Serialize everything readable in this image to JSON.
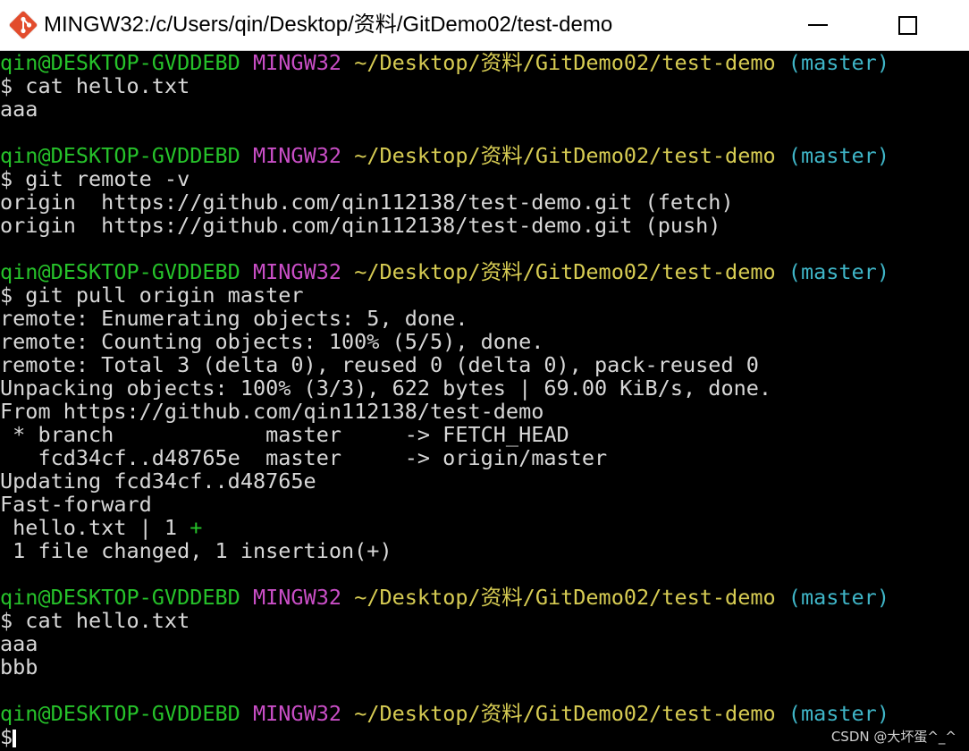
{
  "window": {
    "title": "MINGW32:/c/Users/qin/Desktop/资料/GitDemo02/test-demo",
    "icon": "git-bash-icon"
  },
  "colors": {
    "background": "#000000",
    "text": "#d8d8d8",
    "user_host": "#26c22a",
    "system": "#c94ec6",
    "path": "#d7cc53",
    "branch": "#3fb5c7"
  },
  "terminal": {
    "lines": [
      [
        [
          "qin@DESKTOP-GVDDEBD",
          "green"
        ],
        [
          " ",
          "white"
        ],
        [
          "MINGW32",
          "magenta"
        ],
        [
          " ",
          "white"
        ],
        [
          "~/Desktop/资料/GitDemo02/test-demo",
          "yellow"
        ],
        [
          " ",
          "white"
        ],
        [
          "(master)",
          "cyan"
        ]
      ],
      [
        [
          "$ cat hello.txt",
          "white"
        ]
      ],
      [
        [
          "aaa",
          "white"
        ]
      ],
      [
        [
          "",
          "white"
        ]
      ],
      [
        [
          "qin@DESKTOP-GVDDEBD",
          "green"
        ],
        [
          " ",
          "white"
        ],
        [
          "MINGW32",
          "magenta"
        ],
        [
          " ",
          "white"
        ],
        [
          "~/Desktop/资料/GitDemo02/test-demo",
          "yellow"
        ],
        [
          " ",
          "white"
        ],
        [
          "(master)",
          "cyan"
        ]
      ],
      [
        [
          "$ git remote -v",
          "white"
        ]
      ],
      [
        [
          "origin  https://github.com/qin112138/test-demo.git (fetch)",
          "white"
        ]
      ],
      [
        [
          "origin  https://github.com/qin112138/test-demo.git (push)",
          "white"
        ]
      ],
      [
        [
          "",
          "white"
        ]
      ],
      [
        [
          "qin@DESKTOP-GVDDEBD",
          "green"
        ],
        [
          " ",
          "white"
        ],
        [
          "MINGW32",
          "magenta"
        ],
        [
          " ",
          "white"
        ],
        [
          "~/Desktop/资料/GitDemo02/test-demo",
          "yellow"
        ],
        [
          " ",
          "white"
        ],
        [
          "(master)",
          "cyan"
        ]
      ],
      [
        [
          "$ git pull origin master",
          "white"
        ]
      ],
      [
        [
          "remote: Enumerating objects: 5, done.",
          "white"
        ]
      ],
      [
        [
          "remote: Counting objects: 100% (5/5), done.",
          "white"
        ]
      ],
      [
        [
          "remote: Total 3 (delta 0), reused 0 (delta 0), pack-reused 0",
          "white"
        ]
      ],
      [
        [
          "Unpacking objects: 100% (3/3), 622 bytes | 69.00 KiB/s, done.",
          "white"
        ]
      ],
      [
        [
          "From https://github.com/qin112138/test-demo",
          "white"
        ]
      ],
      [
        [
          " * branch            master     -> FETCH_HEAD",
          "white"
        ]
      ],
      [
        [
          "   fcd34cf..d48765e  master     -> origin/master",
          "white"
        ]
      ],
      [
        [
          "Updating fcd34cf..d48765e",
          "white"
        ]
      ],
      [
        [
          "Fast-forward",
          "white"
        ]
      ],
      [
        [
          " hello.txt | 1 ",
          "white"
        ],
        [
          "+",
          "green"
        ]
      ],
      [
        [
          " 1 file changed, 1 insertion(+)",
          "white"
        ]
      ],
      [
        [
          "",
          "white"
        ]
      ],
      [
        [
          "qin@DESKTOP-GVDDEBD",
          "green"
        ],
        [
          " ",
          "white"
        ],
        [
          "MINGW32",
          "magenta"
        ],
        [
          " ",
          "white"
        ],
        [
          "~/Desktop/资料/GitDemo02/test-demo",
          "yellow"
        ],
        [
          " ",
          "white"
        ],
        [
          "(master)",
          "cyan"
        ]
      ],
      [
        [
          "$ cat hello.txt",
          "white"
        ]
      ],
      [
        [
          "aaa",
          "white"
        ]
      ],
      [
        [
          "bbb",
          "white"
        ]
      ],
      [
        [
          "",
          "white"
        ]
      ],
      [
        [
          "qin@DESKTOP-GVDDEBD",
          "green"
        ],
        [
          " ",
          "white"
        ],
        [
          "MINGW32",
          "magenta"
        ],
        [
          " ",
          "white"
        ],
        [
          "~/Desktop/资料/GitDemo02/test-demo",
          "yellow"
        ],
        [
          " ",
          "white"
        ],
        [
          "(master)",
          "cyan"
        ]
      ],
      [
        [
          "$",
          "white"
        ]
      ]
    ]
  },
  "watermark": "CSDN @大坏蛋^_^"
}
